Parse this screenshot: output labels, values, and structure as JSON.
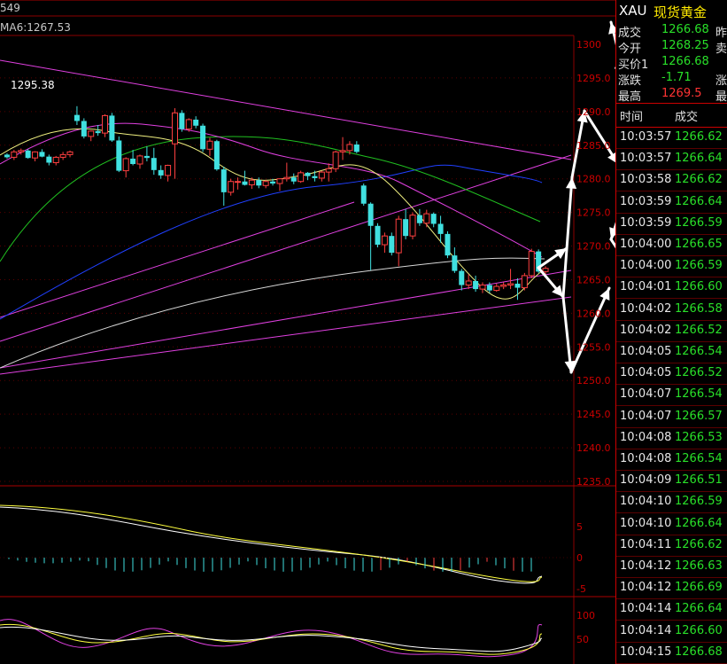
{
  "header": {
    "code": "XAU",
    "name": "现货黄金",
    "left_top_text": "549",
    "ma_text": "MA6:1267.53",
    "price_note": "1295.38"
  },
  "quote": [
    {
      "label": "成交",
      "value": "1266.68",
      "color": "#29e029",
      "label2": "昨"
    },
    {
      "label": "今开",
      "value": "1268.25",
      "color": "#29e029",
      "label2": "卖"
    },
    {
      "label": "买价1",
      "value": "1266.68",
      "color": "#29e029",
      "label2": ""
    },
    {
      "label": "涨跌",
      "value": "-1.71",
      "color": "#29e029",
      "label2": "涨"
    },
    {
      "label": "最高",
      "value": "1269.5",
      "color": "#ff3333",
      "label2": "最"
    }
  ],
  "trades_head": {
    "time": "时间",
    "price": "成交"
  },
  "trades": [
    {
      "time": "10:03:57",
      "price": "1266.62"
    },
    {
      "time": "10:03:57",
      "price": "1266.64"
    },
    {
      "time": "10:03:58",
      "price": "1266.62"
    },
    {
      "time": "10:03:59",
      "price": "1266.64"
    },
    {
      "time": "10:03:59",
      "price": "1266.59"
    },
    {
      "time": "10:04:00",
      "price": "1266.65"
    },
    {
      "time": "10:04:00",
      "price": "1266.59"
    },
    {
      "time": "10:04:01",
      "price": "1266.60"
    },
    {
      "time": "10:04:02",
      "price": "1266.58"
    },
    {
      "time": "10:04:02",
      "price": "1266.52"
    },
    {
      "time": "10:04:05",
      "price": "1266.54"
    },
    {
      "time": "10:04:05",
      "price": "1266.52"
    },
    {
      "time": "10:04:07",
      "price": "1266.54"
    },
    {
      "time": "10:04:07",
      "price": "1266.57"
    },
    {
      "time": "10:04:08",
      "price": "1266.53"
    },
    {
      "time": "10:04:08",
      "price": "1266.54"
    },
    {
      "time": "10:04:09",
      "price": "1266.51"
    },
    {
      "time": "10:04:10",
      "price": "1266.59"
    },
    {
      "time": "10:04:10",
      "price": "1266.64"
    },
    {
      "time": "10:04:11",
      "price": "1266.62"
    },
    {
      "time": "10:04:12",
      "price": "1266.63"
    },
    {
      "time": "10:04:12",
      "price": "1266.69"
    },
    {
      "time": "10:04:14",
      "price": "1266.64"
    },
    {
      "time": "10:04:14",
      "price": "1266.60"
    },
    {
      "time": "10:04:15",
      "price": "1266.68"
    }
  ],
  "price_axis": [
    "1300",
    "1295.0",
    "1290.0",
    "1285.0",
    "1280.0",
    "1275.0",
    "1270.0",
    "1265.0",
    "1260.0",
    "1255.0",
    "1250.0",
    "1245.0",
    "1240.0",
    "1235.0"
  ],
  "macd_axis": [
    "5",
    "0",
    "-5"
  ],
  "kdj_axis": [
    "100",
    "50"
  ],
  "chart_data": {
    "type": "candlestick",
    "ylim": [
      1235,
      1300
    ],
    "candles": [
      [
        1283.6,
        1283.8,
        1283.0,
        1283.2
      ],
      [
        1283.2,
        1284.3,
        1282.8,
        1284.0
      ],
      [
        1284.0,
        1284.5,
        1283.6,
        1284.2
      ],
      [
        1284.2,
        1284.4,
        1283.0,
        1283.1
      ],
      [
        1283.1,
        1284.1,
        1282.6,
        1284.0
      ],
      [
        1284.0,
        1284.4,
        1283.2,
        1283.3
      ],
      [
        1283.3,
        1283.6,
        1282.0,
        1282.4
      ],
      [
        1282.4,
        1283.4,
        1282.0,
        1283.2
      ],
      [
        1283.2,
        1284.0,
        1282.8,
        1283.6
      ],
      [
        1283.6,
        1284.2,
        1283.2,
        1284.0
      ],
      [
        1289.5,
        1290.8,
        1288.0,
        1288.6
      ],
      [
        1288.6,
        1289.0,
        1286.0,
        1286.3
      ],
      [
        1286.3,
        1287.2,
        1285.6,
        1287.1
      ],
      [
        1287.1,
        1288.0,
        1286.4,
        1286.8
      ],
      [
        1286.8,
        1289.6,
        1286.2,
        1289.4
      ],
      [
        1289.4,
        1289.8,
        1285.5,
        1285.7
      ],
      [
        1285.7,
        1286.3,
        1281.0,
        1281.2
      ],
      [
        1281.2,
        1283.2,
        1280.2,
        1283.0
      ],
      [
        1283.0,
        1284.3,
        1282.0,
        1282.2
      ],
      [
        1282.2,
        1283.6,
        1281.5,
        1283.4
      ],
      [
        1283.4,
        1284.8,
        1282.6,
        1283.1
      ],
      [
        1283.1,
        1284.6,
        1280.6,
        1281.3
      ],
      [
        1281.3,
        1282.0,
        1280.0,
        1280.5
      ],
      [
        1280.5,
        1282.1,
        1279.6,
        1282.0
      ],
      [
        1285.2,
        1290.5,
        1280.0,
        1289.8
      ],
      [
        1289.8,
        1290.2,
        1287.0,
        1287.4
      ],
      [
        1287.4,
        1289.0,
        1287.0,
        1288.8
      ],
      [
        1288.8,
        1289.3,
        1287.5,
        1287.9
      ],
      [
        1287.9,
        1288.2,
        1284.0,
        1284.4
      ],
      [
        1284.4,
        1286.1,
        1283.4,
        1285.6
      ],
      [
        1285.6,
        1285.8,
        1281.2,
        1281.4
      ],
      [
        1281.4,
        1281.8,
        1276.0,
        1278.0
      ],
      [
        1278.0,
        1280.0,
        1277.5,
        1279.6
      ],
      [
        1279.6,
        1280.2,
        1278.4,
        1279.6
      ],
      [
        1279.6,
        1281.2,
        1279.0,
        1279.1
      ],
      [
        1279.1,
        1280.2,
        1278.5,
        1279.8
      ],
      [
        1279.8,
        1280.2,
        1278.6,
        1279.0
      ],
      [
        1279.0,
        1279.8,
        1278.6,
        1279.6
      ],
      [
        1279.6,
        1280.0,
        1279.0,
        1279.3
      ],
      [
        1279.3,
        1280.0,
        1278.2,
        1280.0
      ],
      [
        1280.0,
        1282.4,
        1279.6,
        1280.2
      ],
      [
        1280.2,
        1280.8,
        1279.2,
        1279.6
      ],
      [
        1279.6,
        1281.2,
        1279.4,
        1280.9
      ],
      [
        1280.9,
        1281.0,
        1279.8,
        1280.4
      ],
      [
        1280.4,
        1281.2,
        1279.6,
        1280.1
      ],
      [
        1280.1,
        1281.2,
        1279.6,
        1281.0
      ],
      [
        1281.0,
        1282.3,
        1279.6,
        1281.5
      ],
      [
        1281.5,
        1284.2,
        1281.0,
        1284.0
      ],
      [
        1284.0,
        1286.2,
        1282.8,
        1284.2
      ],
      [
        1284.2,
        1285.6,
        1283.6,
        1285.1
      ],
      [
        1285.1,
        1285.6,
        1283.8,
        1284.0
      ],
      [
        1279.0,
        1279.3,
        1276.0,
        1276.3
      ],
      [
        1276.3,
        1276.5,
        1266.4,
        1273.0
      ],
      [
        1273.0,
        1273.4,
        1269.8,
        1270.2
      ],
      [
        1270.2,
        1272.0,
        1269.0,
        1271.5
      ],
      [
        1271.5,
        1272.0,
        1268.6,
        1269.0
      ],
      [
        1269.0,
        1274.5,
        1267.0,
        1274.0
      ],
      [
        1274.0,
        1275.5,
        1271.0,
        1271.5
      ],
      [
        1271.5,
        1275.0,
        1271.0,
        1274.6
      ],
      [
        1274.6,
        1275.5,
        1273.0,
        1273.4
      ],
      [
        1273.4,
        1275.4,
        1272.8,
        1274.8
      ],
      [
        1274.8,
        1275.0,
        1272.8,
        1273.3
      ],
      [
        1273.3,
        1274.5,
        1270.5,
        1271.8
      ],
      [
        1271.8,
        1272.2,
        1268.2,
        1268.6
      ],
      [
        1268.6,
        1269.8,
        1266.0,
        1266.3
      ],
      [
        1266.3,
        1266.6,
        1263.4,
        1264.2
      ],
      [
        1264.2,
        1265.8,
        1263.6,
        1264.8
      ],
      [
        1264.8,
        1265.6,
        1263.2,
        1263.6
      ],
      [
        1263.6,
        1264.6,
        1263.0,
        1264.2
      ],
      [
        1264.2,
        1264.6,
        1263.0,
        1263.4
      ],
      [
        1263.4,
        1264.4,
        1263.2,
        1264.0
      ],
      [
        1264.0,
        1264.6,
        1263.6,
        1264.2
      ],
      [
        1264.2,
        1266.6,
        1263.6,
        1264.4
      ],
      [
        1264.4,
        1265.2,
        1262.0,
        1263.8
      ],
      [
        1263.8,
        1266.0,
        1263.4,
        1265.6
      ],
      [
        1265.6,
        1269.6,
        1265.2,
        1269.2
      ],
      [
        1269.2,
        1269.5,
        1266.0,
        1266.2
      ],
      [
        1266.2,
        1267.0,
        1265.6,
        1266.68
      ]
    ]
  }
}
